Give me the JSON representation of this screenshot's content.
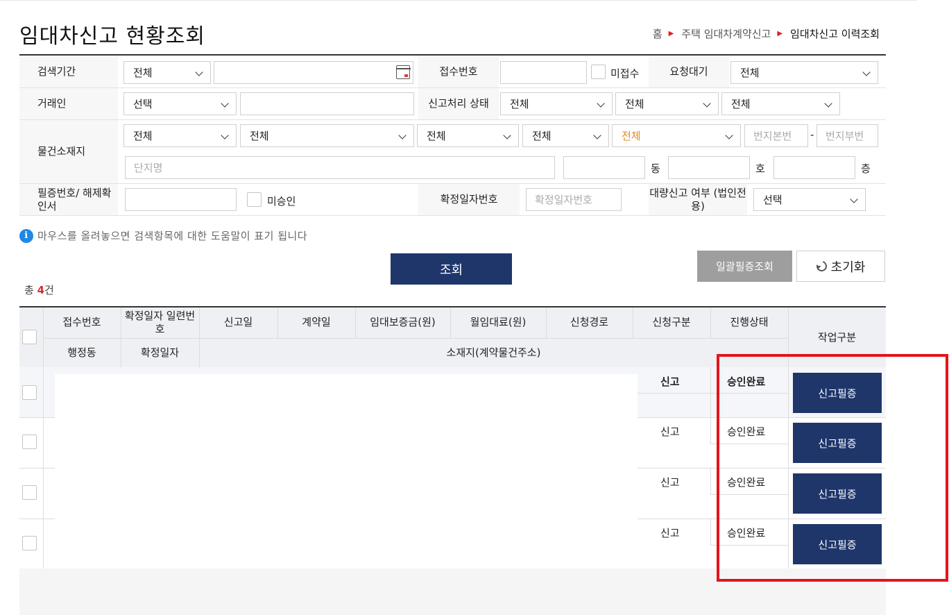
{
  "page": {
    "title": "임대차신고 현황조회",
    "breadcrumb": [
      "홈",
      "주택 임대차계약신고",
      "임대차신고 이력조회"
    ]
  },
  "search": {
    "period": {
      "label": "검색기간",
      "select": "전체",
      "value": ""
    },
    "receipt_no": {
      "label": "접수번호",
      "value": "",
      "unreceived_label": "미접수"
    },
    "request_wait": {
      "label": "요청대기",
      "select": "전체"
    },
    "party": {
      "label": "거래인",
      "select": "선택",
      "value": ""
    },
    "report_status": {
      "label": "신고처리 상태",
      "selects": [
        "전체",
        "전체",
        "전체"
      ]
    },
    "location": {
      "label": "물건소재지",
      "selects": [
        "전체",
        "전체",
        "전체",
        "전체",
        "전체"
      ],
      "lot_main_placeholder": "번지본번",
      "lot_dash": "-",
      "lot_sub_placeholder": "번지부번",
      "complex_placeholder": "단지명",
      "dong_label": "동",
      "ho_label": "호",
      "floor_label": "층"
    },
    "cert_no": {
      "label": "필증번호/ 해제확인서",
      "value": "",
      "unapproved_label": "미승인"
    },
    "fixed_date_no": {
      "label": "확정일자번호",
      "placeholder": "확정일자번호"
    },
    "bulk_report": {
      "label": "대량신고 여부 (법인전용)",
      "select": "선택"
    }
  },
  "help_text": "마우스를 올려놓으면 검색항목에 대한 도움말이 표기 됩니다",
  "buttons": {
    "search": "조회",
    "bulk_cert": "일괄필증조회",
    "reset": "초기화"
  },
  "total": {
    "prefix": "총",
    "count": "4",
    "suffix": "건"
  },
  "table": {
    "headers_top": [
      "접수번호",
      "확정일자 일련번호",
      "신고일",
      "계약일",
      "임대보증금(원)",
      "월임대료(원)",
      "신청경로",
      "신청구분",
      "진행상태"
    ],
    "headers_bottom": [
      "행정동",
      "확정일자",
      "소재지(계약물건주소)"
    ],
    "action_header": "작업구분",
    "rows": [
      {
        "type": "신고",
        "status": "승인완료",
        "action": "신고필증"
      },
      {
        "type": "신고",
        "status": "승인완료",
        "action": "신고필증"
      },
      {
        "type": "신고",
        "status": "승인완료",
        "action": "신고필증"
      },
      {
        "type": "신고",
        "status": "승인완료",
        "action": "신고필증"
      }
    ]
  }
}
